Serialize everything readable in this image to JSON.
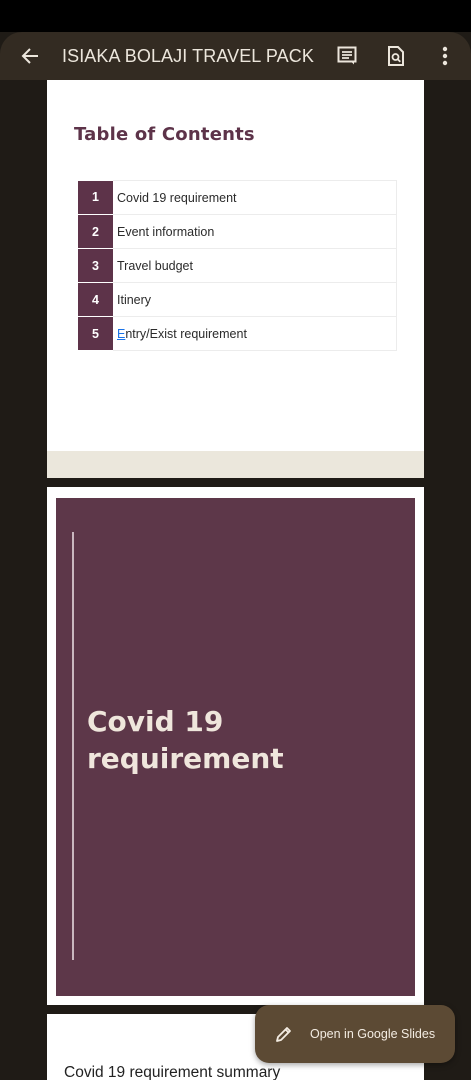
{
  "appbar": {
    "title": "ISIAKA BOLAJI TRAVEL PACK",
    "icons": [
      "back-arrow-icon",
      "comment-icon",
      "find-in-doc-icon",
      "more-vert-icon"
    ]
  },
  "slide1": {
    "title": "Table of Contents",
    "items": [
      {
        "num": "1",
        "label": "Covid 19 requirement"
      },
      {
        "num": "2",
        "label": "Event information"
      },
      {
        "num": "3",
        "label": "Travel budget"
      },
      {
        "num": "4",
        "label": "Itinery"
      },
      {
        "num": "5",
        "label_first": "E",
        "label_rest": "ntry/Exist requirement"
      }
    ]
  },
  "slide2": {
    "heading_line1": "Covid 19",
    "heading_line2": "requirement"
  },
  "slide3": {
    "summary": "Covid 19 requirement summary"
  },
  "fab": {
    "label": "Open in Google Slides"
  },
  "colors": {
    "accent": "#5d3749",
    "appbar": "#332b22",
    "background": "#1f1b16",
    "fab": "#5c4a34"
  }
}
